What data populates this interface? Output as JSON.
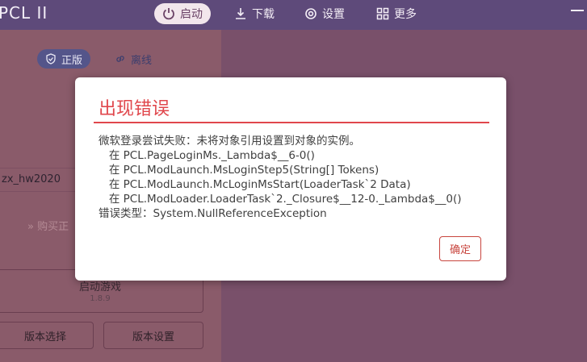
{
  "app": {
    "title": "PCL II"
  },
  "nav": {
    "items": [
      {
        "label": "启动",
        "icon": "power-icon",
        "active": true
      },
      {
        "label": "下载",
        "icon": "download-icon",
        "active": false
      },
      {
        "label": "设置",
        "icon": "settings-icon",
        "active": false
      },
      {
        "label": "更多",
        "icon": "grid-icon",
        "active": false
      }
    ]
  },
  "left": {
    "tab_genuine": "正版",
    "tab_offline": "离线",
    "username": "zx_hw2020",
    "buy_link": "» 购买正",
    "launch_title": "启动游戏",
    "launch_version": "1.8.9",
    "version_select": "版本选择",
    "version_settings": "版本设置"
  },
  "dialog": {
    "title": "出现错误",
    "lines": [
      "微软登录尝试失败：未将对象引用设置到对象的实例。",
      "   在 PCL.PageLoginMs._Lambda$__6-0()",
      "   在 PCL.ModLaunch.MsLoginStep5(String[] Tokens)",
      "   在 PCL.ModLaunch.McLoginMsStart(LoaderTask`2 Data)",
      "   在 PCL.ModLoader.LoaderTask`2._Closure$__12-0._Lambda$__0()",
      "错误类型：System.NullReferenceException"
    ],
    "ok_label": "确定"
  },
  "colors": {
    "accent_red": "#e0474c",
    "topbar": "#5e4a7a"
  }
}
